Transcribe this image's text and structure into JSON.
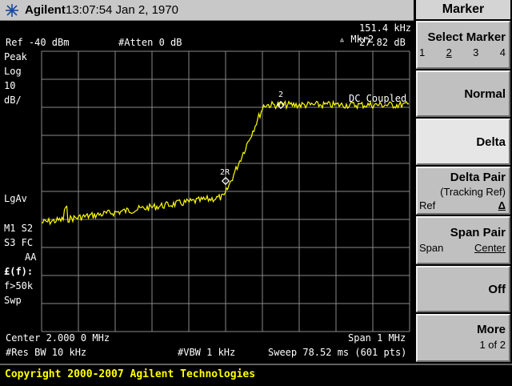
{
  "header": {
    "brand": "Agilent",
    "datetime": "13:07:54  Jan 2, 1970"
  },
  "display": {
    "ref_level": "Ref -40 dBm",
    "atten": "#Atten 0 dB",
    "marker_readout_label": "Mkr2",
    "marker_freq": "151.4 kHz",
    "marker_amp": "27.82 dB",
    "detector": "Peak",
    "scale_type": "Log",
    "scale_value": "10",
    "scale_unit": "dB/",
    "avg_type": "LgAv",
    "m1": "M1  S2",
    "s3": "S3  FC",
    "aa": "AA",
    "corr": "£(f):",
    "fgt": "f>50k",
    "swp": "Swp",
    "dc_coupled": "DC Coupled",
    "marker_2_label": "2",
    "marker_2r_label": "2R",
    "center": "Center 2.000 0 MHz",
    "span": "Span 1 MHz",
    "res_bw": "#Res BW 10 kHz",
    "vbw": "#VBW 1 kHz",
    "sweep": "Sweep 78.52 ms (601 pts)"
  },
  "footer": {
    "copyright": "Copyright 2000-2007 Agilent Technologies"
  },
  "menu": {
    "title": "Marker",
    "keys": [
      {
        "label": "Select Marker",
        "options": [
          "1",
          "2",
          "3",
          "4"
        ],
        "selected": "2"
      },
      {
        "label": "Normal"
      },
      {
        "label": "Delta",
        "active": true
      },
      {
        "label": "Delta Pair",
        "sub": "(Tracking Ref)",
        "left": "Ref",
        "right": "Δ"
      },
      {
        "label": "Span Pair",
        "left": "Span",
        "right": "Center"
      },
      {
        "label": "Off"
      },
      {
        "label": "More",
        "sub": "1 of 2"
      }
    ]
  },
  "colors": {
    "trace": "#ffff00",
    "grid": "#8a8a8a",
    "marker": "#ffffff"
  }
}
